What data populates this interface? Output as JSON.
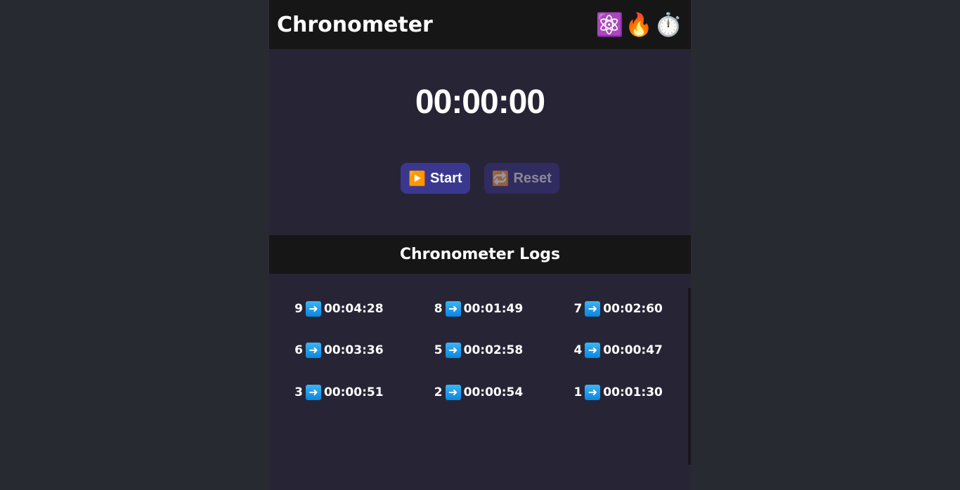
{
  "header": {
    "title": "Chronometer",
    "icons": [
      {
        "name": "atom-icon",
        "glyph": "⚛️"
      },
      {
        "name": "fire-icon",
        "glyph": "🔥"
      },
      {
        "name": "stopwatch-icon",
        "glyph": "⏱️"
      }
    ]
  },
  "timer": {
    "display": "00:00:00"
  },
  "controls": {
    "start_label": "Start",
    "start_icon": "▶️",
    "reset_label": "Reset",
    "reset_icon": "🔁",
    "start_color": "#3a378e",
    "reset_color": "#302c60"
  },
  "logs": {
    "title": "Chronometer Logs",
    "items": [
      {
        "index": "9",
        "time": "00:04:28"
      },
      {
        "index": "8",
        "time": "00:01:49"
      },
      {
        "index": "7",
        "time": "00:02:60"
      },
      {
        "index": "6",
        "time": "00:03:36"
      },
      {
        "index": "5",
        "time": "00:02:58"
      },
      {
        "index": "4",
        "time": "00:00:47"
      },
      {
        "index": "3",
        "time": "00:00:51"
      },
      {
        "index": "2",
        "time": "00:00:54"
      },
      {
        "index": "1",
        "time": "00:01:30"
      }
    ]
  }
}
